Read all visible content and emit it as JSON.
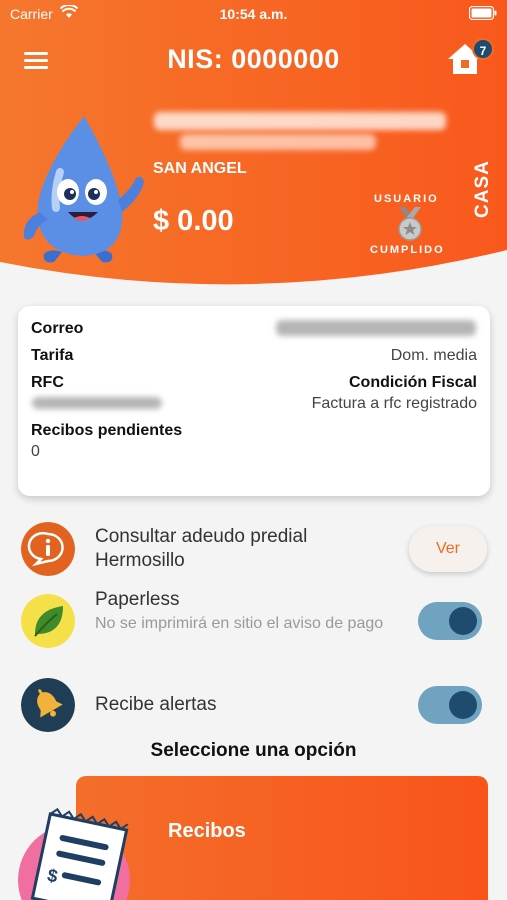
{
  "status_bar": {
    "carrier": "Carrier",
    "time": "10:54 a.m."
  },
  "header": {
    "title": "NIS: 0000000",
    "notification_count": "7",
    "location": "SAN ANGEL",
    "balance": "$ 0.00",
    "badge_top": "USUARIO",
    "badge_bottom": "CUMPLIDO",
    "property_type": "CASA"
  },
  "info": {
    "correo_label": "Correo",
    "tarifa_label": "Tarifa",
    "tarifa_value": "Dom. media",
    "rfc_label": "RFC",
    "condicion_label": "Condición Fiscal",
    "condicion_value": "Factura a rfc registrado",
    "recibos_label": "Recibos pendientes",
    "recibos_value": "0"
  },
  "options": {
    "predial_title": "Consultar adeudo predial Hermosillo",
    "ver_label": "Ver",
    "paperless_title": "Paperless",
    "paperless_sub": "No se imprimirá en sitio el aviso de pago",
    "paperless_on": true,
    "alertas_title": "Recibe alertas",
    "alertas_on": true
  },
  "section_title": "Seleccione una opción",
  "recibos_card": {
    "title": "Recibos"
  },
  "colors": {
    "brand_orange": "#f36a24",
    "navy": "#1e4b6e",
    "toggle_track": "#6fa3bf"
  }
}
